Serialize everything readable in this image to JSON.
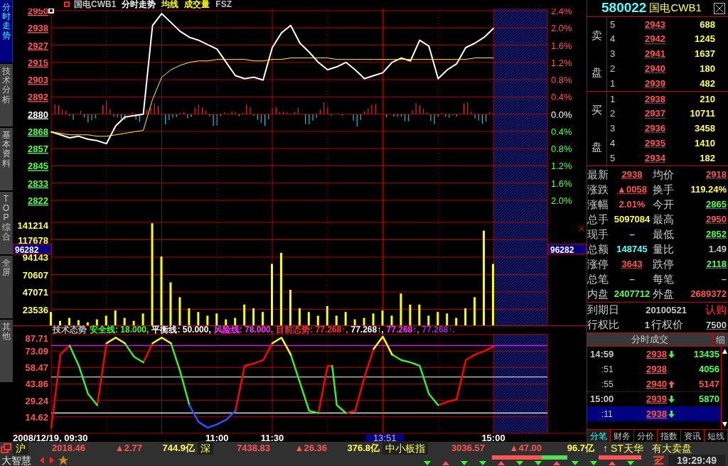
{
  "header": [
    {
      "text": "国电CWB1",
      "color": "#c0c0c0"
    },
    {
      "text": "分时走势",
      "color": "#ffffff"
    },
    {
      "text": "均线",
      "color": "#ffff00"
    },
    {
      "text": "成交量",
      "color": "#ffff00"
    },
    {
      "text": "FSZ",
      "color": "#c0c0c0"
    }
  ],
  "side_tabs": [
    {
      "label": "分时走势",
      "selected": true
    },
    {
      "label": "技术分析",
      "selected": false
    },
    {
      "label": "基本资料",
      "selected": false
    },
    {
      "label": "TOP综合",
      "selected": false
    },
    {
      "label": "全屏",
      "selected": false
    },
    {
      "label": "其他",
      "selected": false
    }
  ],
  "price_chart": {
    "chart_data": {
      "type": "line",
      "series": [
        {
          "color": "#ffffff",
          "values": [
            2868,
            2866,
            2864,
            2865,
            2863,
            2862,
            2860,
            2872,
            2878,
            2879,
            2880,
            2940,
            2948,
            2942,
            2936,
            2932,
            2930,
            2927,
            2924,
            2915,
            2906,
            2904,
            2905,
            2903,
            2925,
            2935,
            2940,
            2928,
            2922,
            2915,
            2910,
            2912,
            2915,
            2910,
            2904,
            2906,
            2908,
            2915,
            2918,
            2916,
            2930,
            2926,
            2904,
            2910,
            2914,
            2925,
            2928,
            2932,
            2938
          ]
        },
        {
          "color": "#ffff00",
          "values": [
            2868,
            2867,
            2866,
            2866,
            2866,
            2865,
            2865,
            2866,
            2867,
            2868,
            2869,
            2890,
            2905,
            2910,
            2913,
            2915,
            2916,
            2916,
            2917,
            2917,
            2917,
            2917,
            2916,
            2916,
            2917,
            2917,
            2918,
            2918,
            2918,
            2918,
            2918,
            2917,
            2917,
            2917,
            2917,
            2917,
            2917,
            2917,
            2917,
            2917,
            2917,
            2917,
            2917,
            2917,
            2917,
            2917,
            2918,
            2918,
            2918
          ]
        }
      ],
      "ylim": [
        2821.67,
        2950
      ],
      "grid": true,
      "yticks": [
        {
          "value": 2950,
          "label": "2950"
        },
        {
          "value": 2938.33,
          "label": "2938"
        },
        {
          "value": 2926.67,
          "label": "2927"
        },
        {
          "value": 2915,
          "label": "2915"
        },
        {
          "value": 2903.33,
          "label": "2903"
        },
        {
          "value": 2891.67,
          "label": "2892"
        },
        {
          "value": 2880,
          "label": "2880"
        },
        {
          "value": 2868.33,
          "label": "2868"
        },
        {
          "value": 2856.67,
          "label": "2857"
        },
        {
          "value": 2845,
          "label": "2845"
        },
        {
          "value": 2833.33,
          "label": "2833"
        },
        {
          "value": 2821.67,
          "label": "2822"
        }
      ]
    },
    "percent_axis": [
      {
        "label": "2.4%",
        "color": "#ff5555"
      },
      {
        "label": "2.0%",
        "color": "#ff5555"
      },
      {
        "label": "1.6%",
        "color": "#ff5555"
      },
      {
        "label": "1.2%",
        "color": "#ff5555"
      },
      {
        "label": "0.8%",
        "color": "#ff5555"
      },
      {
        "label": "0.4%",
        "color": "#ff5555"
      },
      {
        "label": "0.0%",
        "color": "#ffffff"
      },
      {
        "label": "0.4%",
        "color": "#55ff55"
      },
      {
        "label": "0.8%",
        "color": "#55ff55"
      },
      {
        "label": "1.2%",
        "color": "#55ff55"
      },
      {
        "label": "1.6%",
        "color": "#55ff55"
      },
      {
        "label": "2.0%",
        "color": "#55ff55"
      }
    ]
  },
  "volume_chart": {
    "chart_data": {
      "type": "bar",
      "series": [
        {
          "color": "#ffff00",
          "values": [
            20000,
            8000,
            12000,
            9000,
            6000,
            10000,
            15000,
            22000,
            12000,
            8000,
            18000,
            140000,
            95000,
            60000,
            40000,
            25000,
            20000,
            15000,
            18000,
            10000,
            12000,
            30000,
            25000,
            20000,
            85000,
            100000,
            50000,
            25000,
            20000,
            15000,
            28000,
            15000,
            20000,
            10000,
            12000,
            18000,
            22000,
            15000,
            45000,
            30000,
            30000,
            15000,
            20000,
            18000,
            12000,
            25000,
            40000,
            130000,
            85000
          ]
        }
      ],
      "ylim": [
        0,
        144100
      ],
      "grid": true,
      "yticks": [
        23536,
        47071,
        70607,
        94143,
        117678,
        141214
      ]
    },
    "cursor_labels": [
      "96282",
      "96282"
    ]
  },
  "indicator": {
    "legend": [
      {
        "text": "技术态势",
        "color": "#c0c0c0"
      },
      {
        "text": "安全线: 18.000,",
        "color": "#33ff33"
      },
      {
        "text": "平衡线: 50.000,",
        "color": "#ffffff"
      },
      {
        "text": "风险线: 78.000,",
        "color": "#ff33ff"
      },
      {
        "text": "目前态势: 77.268↑,",
        "color": "#ff3333"
      },
      {
        "text": "77.268↑,",
        "color": "#ffffff"
      },
      {
        "text": "77.268↑,",
        "color": "#ff33ff"
      },
      {
        "text": "77.268↑.",
        "color": "#9933cc"
      }
    ],
    "chart_data": {
      "type": "line",
      "categories": [
        "2008/12/19, 09:30",
        null,
        null,
        null,
        null,
        null,
        null,
        null,
        null,
        null,
        null,
        null,
        null,
        null,
        null,
        null,
        null,
        null,
        null,
        null,
        null,
        null,
        null,
        null,
        null,
        null,
        null,
        null,
        null,
        null,
        null,
        null,
        null,
        null,
        null,
        null,
        "11:00",
        null,
        null,
        null,
        null,
        null,
        null,
        null,
        null,
        null,
        null,
        null,
        "11:30",
        null,
        null,
        null,
        null,
        null,
        null,
        null,
        null,
        null,
        null,
        null,
        null,
        null,
        null,
        null,
        null,
        null,
        null,
        null,
        null,
        null,
        null,
        null,
        null,
        null,
        null,
        null,
        null,
        null,
        null,
        null,
        null,
        null,
        null,
        null,
        null,
        null,
        null,
        null,
        null,
        null,
        null,
        null,
        null,
        null,
        null,
        null,
        "15:00"
      ],
      "series": [
        {
          "color": "#ff0000",
          "values": [
            5,
            37.5,
            70,
            74,
            78,
            null,
            null,
            null,
            null,
            null,
            25,
            52.5,
            80,
            null,
            null,
            null,
            null,
            null,
            null,
            null,
            63,
            71.5,
            80,
            null,
            null,
            null,
            null,
            null,
            null,
            null,
            null,
            null,
            null,
            null,
            null,
            null,
            null,
            null,
            null,
            null,
            20,
            40,
            60,
            61,
            62,
            63.5,
            65,
            72.5,
            80,
            null,
            null,
            null,
            null,
            null,
            null,
            null,
            null,
            null,
            18,
            39,
            60,
            60,
            null,
            null,
            18,
            19,
            20,
            35,
            50,
            62.5,
            75,
            null,
            null,
            null,
            null,
            null,
            null,
            null,
            null,
            null,
            null,
            null,
            null,
            null,
            25,
            26.5,
            28,
            29,
            30,
            47.5,
            65,
            67.5,
            70,
            71.5,
            73,
            75,
            77
          ]
        },
        {
          "color": "#33ee33",
          "values": [
            null,
            null,
            null,
            null,
            78,
            69,
            60,
            47.5,
            35,
            30,
            25,
            null,
            null,
            null,
            null,
            null,
            80,
            74,
            68,
            65.5,
            63,
            null,
            null,
            null,
            null,
            null,
            80,
            67.5,
            55,
            40,
            25,
            null,
            null,
            null,
            null,
            null,
            null,
            null,
            null,
            null,
            null,
            null,
            null,
            null,
            null,
            null,
            null,
            null,
            null,
            null,
            null,
            null,
            70,
            57.5,
            45,
            32.5,
            20,
            19,
            18,
            null,
            null,
            60,
            25,
            21.5,
            18,
            null,
            null,
            null,
            null,
            null,
            null,
            null,
            null,
            null,
            70,
            67.5,
            65,
            64,
            63,
            61.5,
            60,
            47.5,
            35,
            30,
            25,
            null,
            null,
            null,
            null,
            null,
            null,
            null,
            null,
            null,
            null,
            null,
            null
          ]
        },
        {
          "color": "#ffff00",
          "values": [
            null,
            null,
            null,
            null,
            null,
            null,
            null,
            null,
            null,
            null,
            null,
            null,
            80,
            82.5,
            85,
            82.5,
            80,
            null,
            null,
            null,
            null,
            null,
            80,
            82.5,
            85,
            82.5,
            80,
            null,
            null,
            null,
            null,
            null,
            null,
            null,
            null,
            null,
            null,
            null,
            null,
            null,
            null,
            null,
            null,
            null,
            null,
            null,
            null,
            null,
            80,
            82.5,
            85,
            77.5,
            70,
            null,
            null,
            null,
            null,
            null,
            null,
            null,
            null,
            null,
            null,
            null,
            null,
            null,
            null,
            null,
            null,
            null,
            75,
            80.5,
            86,
            78,
            70,
            null,
            null,
            null,
            null,
            null,
            null,
            null,
            null,
            null,
            null,
            null,
            null,
            null,
            null,
            null,
            null,
            null,
            null,
            null,
            null,
            null,
            null
          ]
        },
        {
          "color": "#3050ff",
          "values": [
            null,
            null,
            null,
            null,
            null,
            null,
            null,
            null,
            null,
            null,
            null,
            null,
            null,
            null,
            null,
            null,
            null,
            null,
            null,
            null,
            null,
            null,
            null,
            null,
            null,
            null,
            null,
            null,
            null,
            null,
            25,
            17.5,
            10,
            7.5,
            5,
            6.5,
            8,
            10,
            12,
            16,
            20,
            null,
            null,
            null,
            null,
            null,
            null,
            null,
            null,
            null,
            null,
            null,
            null,
            null,
            null,
            null,
            null,
            null,
            null,
            null,
            null,
            null,
            null,
            null,
            null,
            null,
            null,
            null,
            null,
            null,
            null,
            null,
            null,
            null,
            null,
            null,
            null,
            null,
            null,
            null,
            null,
            null,
            null,
            null,
            null,
            null,
            null,
            null,
            null,
            null,
            null,
            null,
            null,
            null,
            null,
            null,
            null
          ]
        }
      ],
      "ylim": [
        0,
        88.34
      ],
      "grid": true,
      "yticks": [
        14.62,
        29.24,
        43.86,
        58.47,
        73.09,
        87.71
      ],
      "ref_lines": [
        {
          "axis": "y",
          "value": 78,
          "color": "#ff00ff"
        },
        {
          "axis": "y",
          "value": 50,
          "color": "#ffffff"
        },
        {
          "axis": "y",
          "value": 18,
          "color": "#ffffff"
        }
      ]
    },
    "cursor_time": "13:51"
  },
  "quote": {
    "code": "580022",
    "name": "国电CWB1",
    "sell_label": [
      "卖",
      "盘"
    ],
    "buy_label": [
      "买",
      "盘"
    ],
    "asks": [
      {
        "rank": "5",
        "price": "2943",
        "volume": "688"
      },
      {
        "rank": "4",
        "price": "2942",
        "volume": "1245"
      },
      {
        "rank": "3",
        "price": "2941",
        "volume": "1637"
      },
      {
        "rank": "2",
        "price": "2940",
        "volume": "180"
      },
      {
        "rank": "1",
        "price": "2939",
        "volume": "482"
      }
    ],
    "bids": [
      {
        "rank": "1",
        "price": "2938",
        "volume": "210"
      },
      {
        "rank": "2",
        "price": "2937",
        "volume": "10711"
      },
      {
        "rank": "3",
        "price": "2936",
        "volume": "3458"
      },
      {
        "rank": "4",
        "price": "2935",
        "volume": "1410"
      },
      {
        "rank": "5",
        "price": "2934",
        "volume": "182"
      }
    ],
    "stats": [
      {
        "label": "最新",
        "value": "2938",
        "color": "#ff5555",
        "kind": "price"
      },
      {
        "label": "均价",
        "value": "2918",
        "color": "#ff5555",
        "kind": "price"
      },
      {
        "label": "涨跌",
        "value": "▲0058",
        "color": "#ff5555",
        "kind": "price"
      },
      {
        "label": "换手",
        "value": "119.24%",
        "color": "#ffff55",
        "kind": "plain"
      },
      {
        "label": "涨幅",
        "value": "2.01%",
        "color": "#ff5555",
        "kind": "plain"
      },
      {
        "label": "今开",
        "value": "2865",
        "color": "#55ff55",
        "kind": "price"
      },
      {
        "label": "总手",
        "value": "5097084",
        "color": "#ffff55",
        "kind": "plain"
      },
      {
        "label": "最高",
        "value": "2950",
        "color": "#ff5555",
        "kind": "price"
      },
      {
        "label": "现手",
        "value": "–",
        "color": "#55ffff",
        "kind": "plain"
      },
      {
        "label": "最低",
        "value": "2852",
        "color": "#55ff55",
        "kind": "price"
      },
      {
        "label": "总额",
        "value": "148745",
        "color": "#55ffff",
        "kind": "plain"
      },
      {
        "label": "量比",
        "value": "1.49",
        "color": "#c0c0c0",
        "kind": "plain"
      },
      {
        "label": "涨停",
        "value": "3643",
        "color": "#ff5555",
        "kind": "price"
      },
      {
        "label": "跌停",
        "value": "2118",
        "color": "#55ff55",
        "kind": "price"
      },
      {
        "label": "总笔",
        "value": "–",
        "color": "#c0c0c0",
        "kind": "plain"
      },
      {
        "label": "每笔",
        "value": "–",
        "color": "#c0c0c0",
        "kind": "plain"
      },
      {
        "label": "内盘",
        "value": "2407712",
        "color": "#55ff55",
        "kind": "plain"
      },
      {
        "label": "外盘",
        "value": "2689372",
        "color": "#ff5555",
        "kind": "plain"
      }
    ],
    "option": {
      "expiry_label": "到期日",
      "expiry": "20100521",
      "type": "认购",
      "ratio_label": "行权比",
      "ratio": "1",
      "strike_label": "行权价",
      "strike": "7500"
    }
  },
  "trades": {
    "title": "分时成交",
    "detail_button": "细",
    "rows": [
      {
        "kind": "minute",
        "time": "14:59",
        "price": "2938",
        "arrow_up": false,
        "arrow_down": true,
        "volume": "13435",
        "color": "#55ff55",
        "selected": false
      },
      {
        "kind": "second",
        "time": ":51",
        "price": "2938",
        "arrow_up": false,
        "arrow_down": false,
        "volume": "4056",
        "color": "#55ff55",
        "selected": false
      },
      {
        "kind": "second",
        "time": ":55",
        "price": "2940",
        "arrow_up": true,
        "arrow_down": false,
        "volume": "5147",
        "color": "#ff5555",
        "selected": false
      },
      {
        "kind": "minute",
        "time": "15:00",
        "price": "2939",
        "arrow_up": false,
        "arrow_down": true,
        "volume": "5870",
        "color": "#55ff55",
        "selected": false
      },
      {
        "kind": "second",
        "time": ":11",
        "price": "2938",
        "arrow_up": false,
        "arrow_down": true,
        "selected": true
      }
    ]
  },
  "panel_tabs": [
    {
      "label": "分笔",
      "selected": true
    },
    {
      "label": "财务",
      "selected": false
    },
    {
      "label": "分价",
      "selected": false
    },
    {
      "label": "指数",
      "selected": false
    },
    {
      "label": "资讯",
      "selected": false
    },
    {
      "label": "短线",
      "selected": false
    }
  ],
  "status_bar": {
    "markets": [
      {
        "name": "沪",
        "index": "2018.46",
        "change": "▲2.77",
        "amount": "744.9亿"
      },
      {
        "name": "深",
        "index": "7438.83",
        "change": "▲26.36",
        "amount": "376.8亿"
      },
      {
        "name": "中小板指",
        "index": "3036.57",
        "change": "▲47.00",
        "amount": "96.7亿"
      }
    ],
    "alert_stock": "↑ ST天华",
    "alert_message": "有大卖盘",
    "brand": "大智慧",
    "clock": "19:29:49"
  }
}
